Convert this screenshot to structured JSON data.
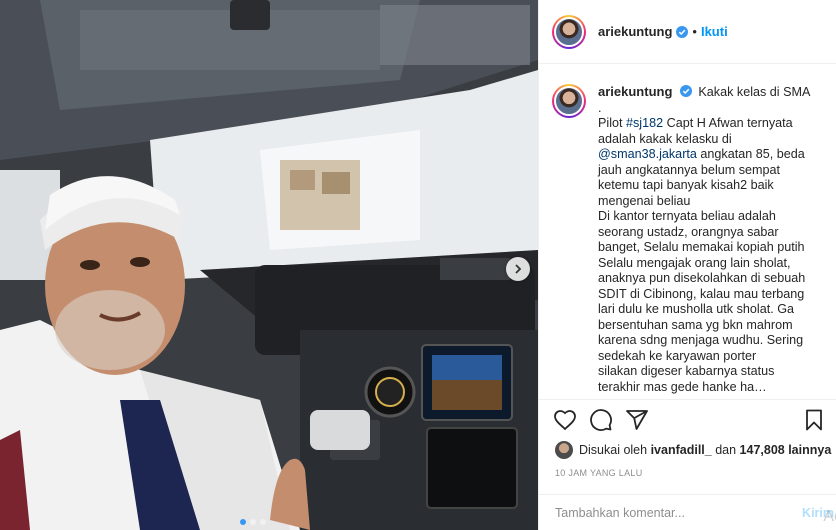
{
  "post": {
    "author": "ariekuntung",
    "follow_label": "Ikuti",
    "separator": "•",
    "caption_first": "Kakak kelas di SMA",
    "caption_parts": [
      {
        "text": "\n.\nPilot ",
        "type": "text"
      },
      {
        "text": "#sj182",
        "type": "link"
      },
      {
        "text": " Capt H Afwan ternyata adalah kakak kelasku di ",
        "type": "text"
      },
      {
        "text": "@sman38.jakarta",
        "type": "link"
      },
      {
        "text": " angkatan 85, beda jauh angkatannya belum sempat ketemu tapi banyak kisah2 baik mengenai beliau\nDi kantor ternyata beliau adalah seorang ustadz, orangnya sabar banget, Selalu memakai kopiah putih Selalu mengajak orang lain sholat, anaknya pun disekolahkan di sebuah SDIT di Cibinong, kalau mau terbang lari dulu ke musholla utk sholat. Ga bersentuhan sama yg bkn mahrom karena sdng menjaga wudhu. Sering sedekah ke karyawan porter\nsilakan digeser kabarnya status\nterakhir mas gede hanke ha…",
        "type": "text"
      }
    ],
    "liked_by_prefix": "Disukai oleh",
    "liked_by_user": "ivanfadill_",
    "liked_by_middle": "dan",
    "liked_by_count": "147,808 lainnya",
    "time_ago": "10 JAM YANG LALU",
    "comment_placeholder": "Tambahkan komentar...",
    "post_label": "Kirim",
    "watermark": "Ac"
  },
  "icons": {
    "verified": "verified-badge-icon",
    "like": "heart-icon",
    "comment": "comment-icon",
    "share": "share-icon",
    "save": "bookmark-icon",
    "next": "chevron-right-icon"
  },
  "colors": {
    "accent": "#0095f6",
    "link": "#00376b",
    "text": "#262626",
    "muted": "#8e8e8e",
    "border": "#efefef"
  },
  "carousel": {
    "total": 3,
    "active": 1
  }
}
